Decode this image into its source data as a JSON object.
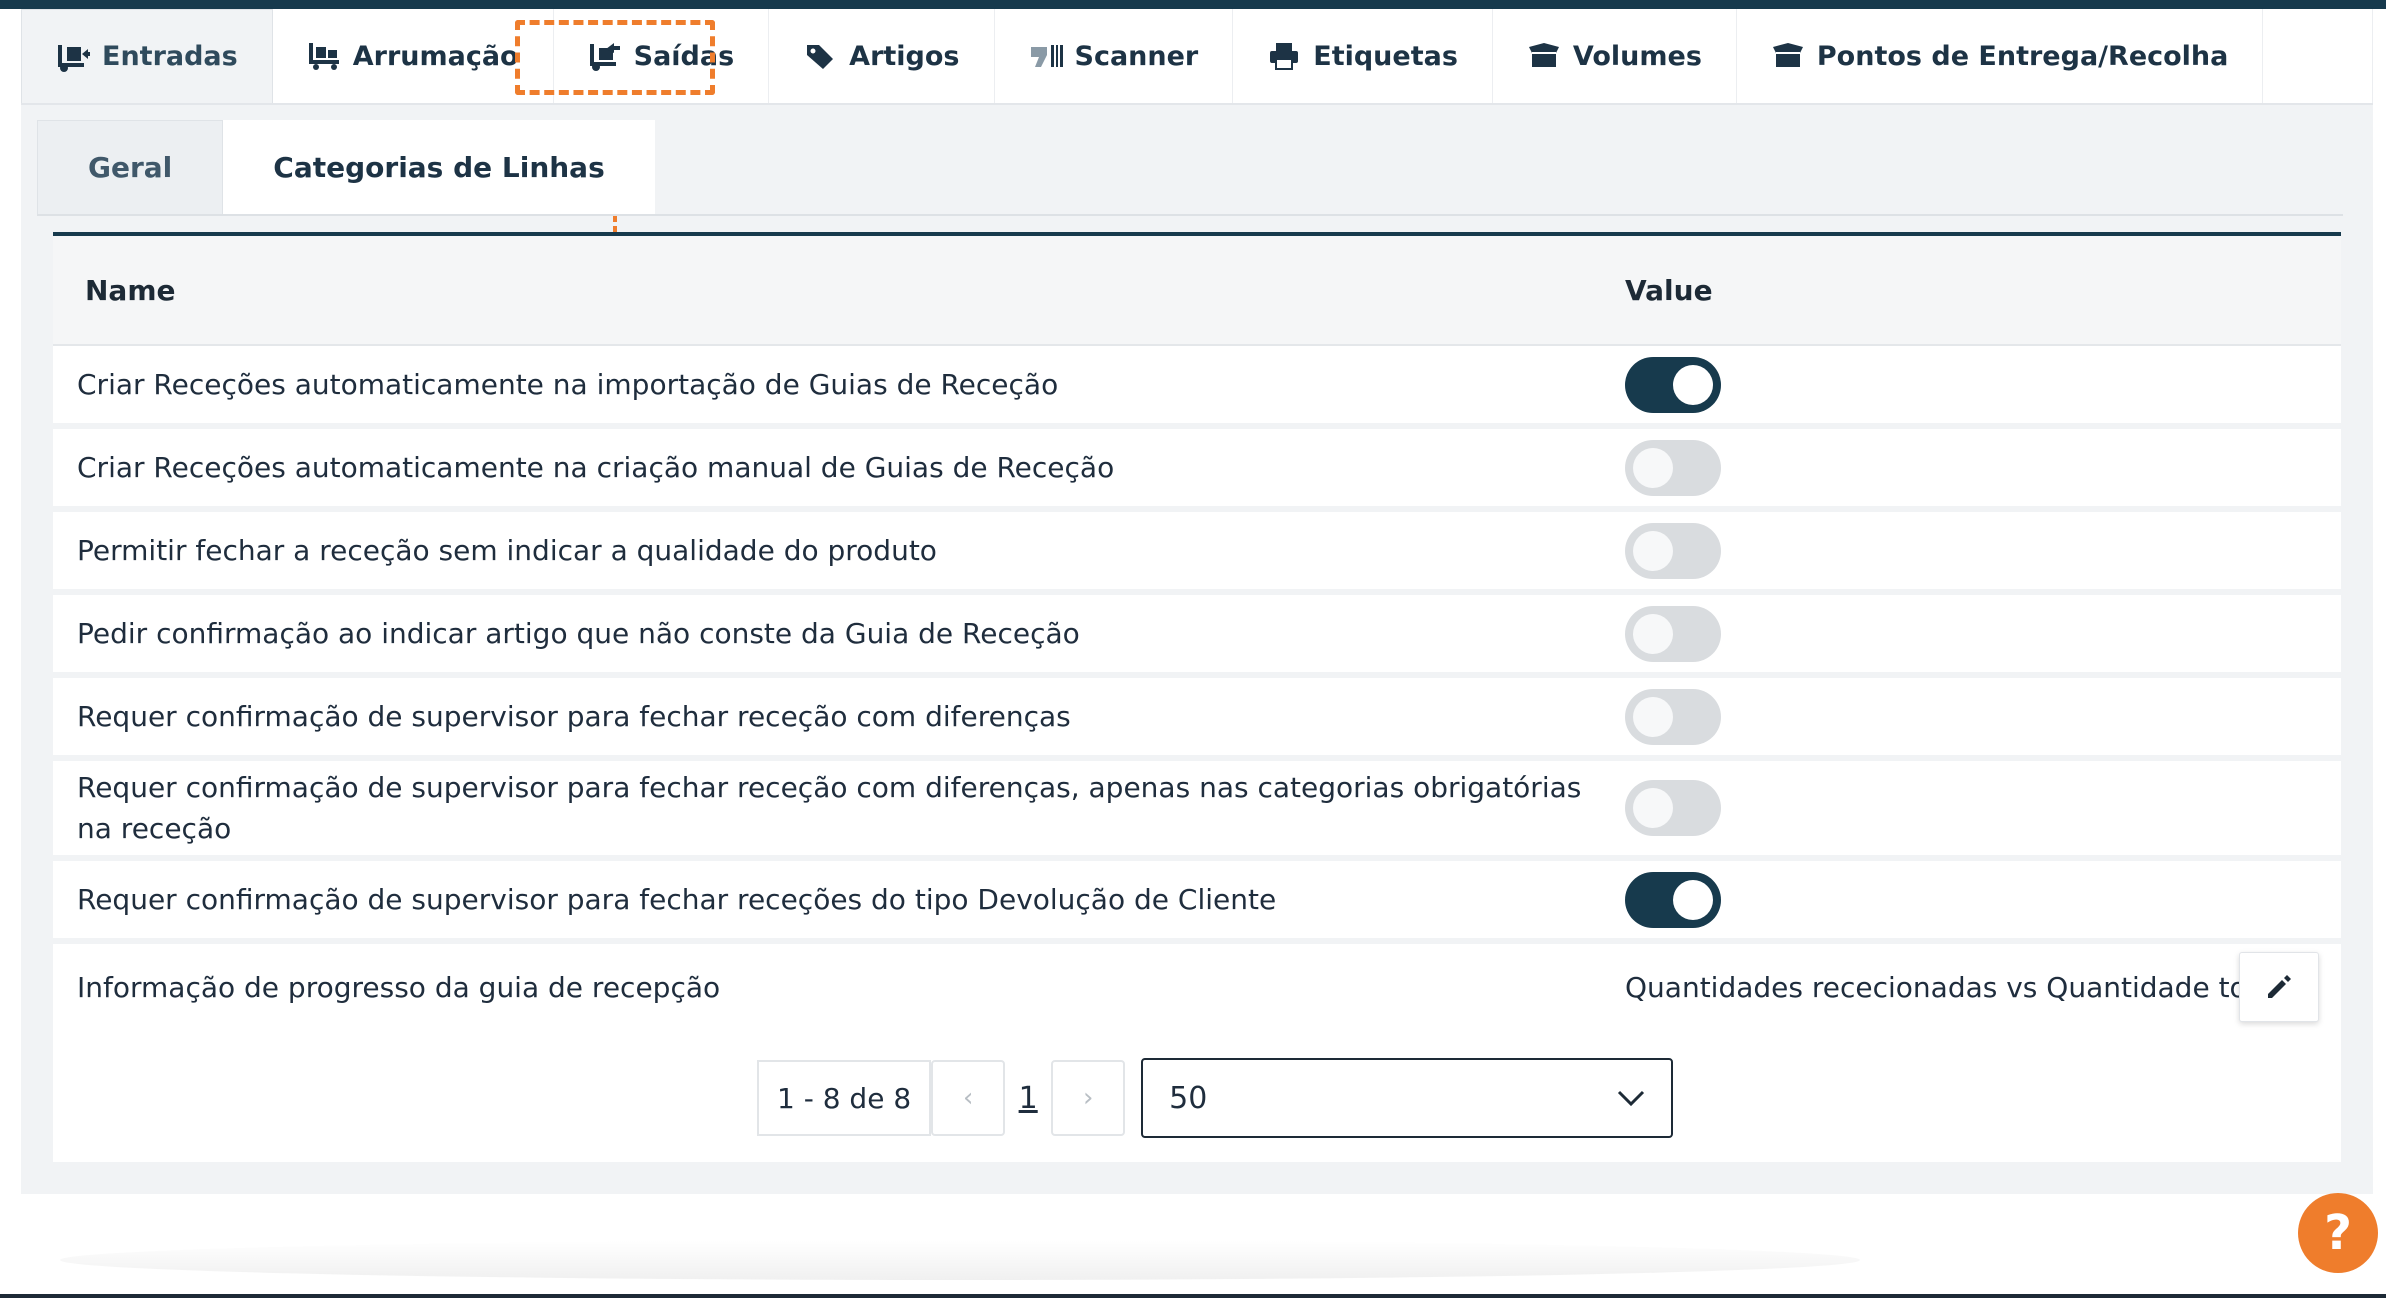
{
  "main_tabs": [
    {
      "label": "Entradas",
      "icon": "dolly-in-icon",
      "active": true
    },
    {
      "label": "Arrumação",
      "icon": "pallet-truck-icon"
    },
    {
      "label": "Saídas",
      "icon": "dolly-out-icon"
    },
    {
      "label": "Artigos",
      "icon": "tag-icon"
    },
    {
      "label": "Scanner",
      "icon": "barcode-scanner-icon"
    },
    {
      "label": "Etiquetas",
      "icon": "printer-icon"
    },
    {
      "label": "Volumes",
      "icon": "box-open-icon"
    },
    {
      "label": "Pontos de Entrega/Recolha",
      "icon": "box-open-icon"
    }
  ],
  "sub_tabs": [
    {
      "label": "Geral"
    },
    {
      "label": "Categorias de Linhas"
    }
  ],
  "table": {
    "headers": {
      "name": "Name",
      "value": "Value"
    },
    "rows": [
      {
        "name": "Criar Receções automaticamente na importação de Guias de Receção",
        "on": true
      },
      {
        "name": "Criar Receções automaticamente na criação manual de Guias de Receção",
        "on": false
      },
      {
        "name": "Permitir fechar a receção sem indicar a qualidade do produto",
        "on": false
      },
      {
        "name": "Pedir confirmação ao indicar artigo que não conste da Guia de Receção",
        "on": false
      },
      {
        "name": "Requer confirmação de supervisor para fechar receção com diferenças",
        "on": false
      },
      {
        "name": "Requer confirmação de supervisor para fechar receção com diferenças, apenas nas categorias obrigatórias na receção",
        "on": false
      },
      {
        "name": "Requer confirmação de supervisor para fechar receções do tipo Devolução de Cliente",
        "on": true
      },
      {
        "name": "Informação de progresso da guia de recepção",
        "value": "Quantidades rececionadas vs Quantidade totais"
      }
    ]
  },
  "pagination": {
    "range": "1 - 8 de 8",
    "prev": "‹",
    "page": "1",
    "next": "›",
    "page_size": "50"
  },
  "help": {
    "label": "?"
  },
  "colors": {
    "accent": "#ef7d2c",
    "primary": "#173a4d",
    "toggle_off": "#d9dcdf"
  }
}
